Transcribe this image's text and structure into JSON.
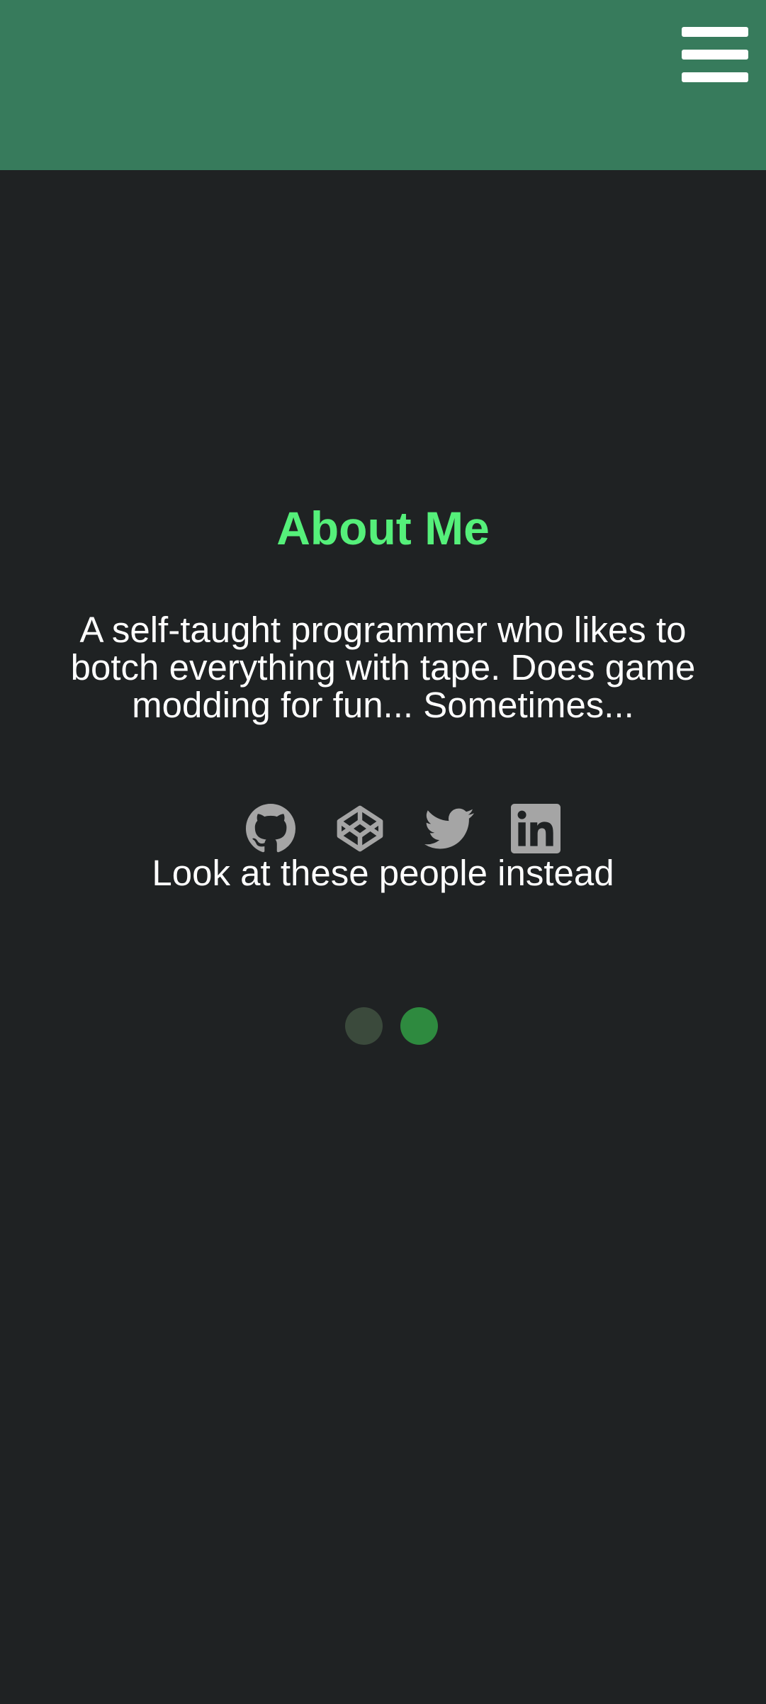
{
  "header": {
    "menu_icon": "hamburger-menu-icon",
    "color": "#377b5c"
  },
  "about": {
    "title": "About Me",
    "title_color": "#55f07a",
    "bio": "A self-taught programmer who likes to botch everything with tape. Does game modding for fun... Sometimes..."
  },
  "socials": [
    {
      "name": "GitHub",
      "icon": "github-icon"
    },
    {
      "name": "CodePen",
      "icon": "codepen-icon"
    },
    {
      "name": "Twitter",
      "icon": "twitter-icon"
    },
    {
      "name": "LinkedIn",
      "icon": "linkedin-icon"
    }
  ],
  "tagline": "Look at these people instead",
  "pagination": {
    "count": 2,
    "active_index": 1,
    "inactive_color": "#3b4a3c",
    "active_color": "#2e8a3f"
  },
  "colors": {
    "background": "#1f2223",
    "icon": "#a5a5a5"
  }
}
